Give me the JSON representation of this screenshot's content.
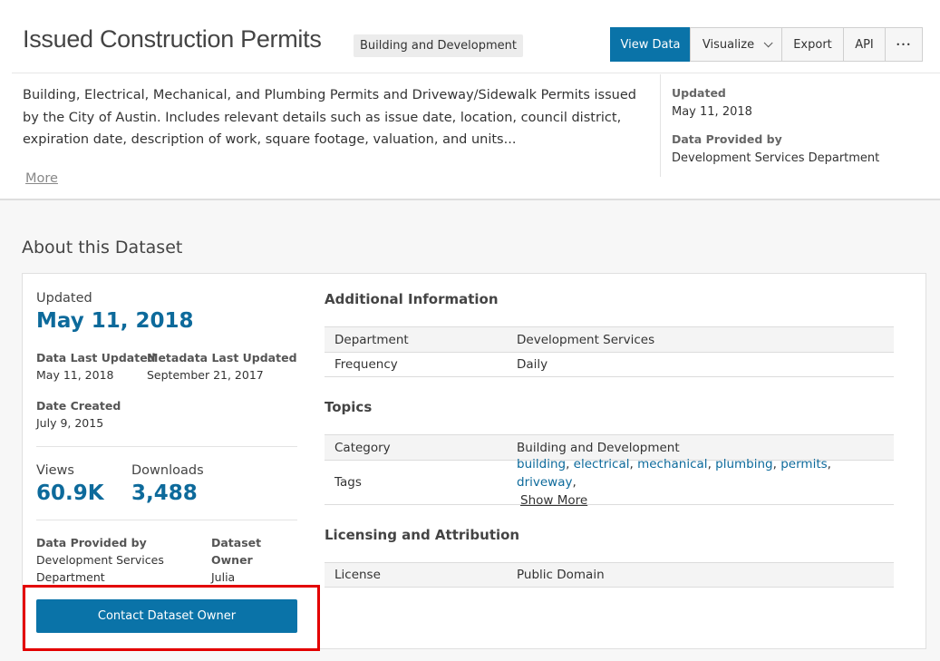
{
  "header": {
    "title": "Issued Construction Permits",
    "category": "Building and Development",
    "buttons": {
      "view_data": "View Data",
      "visualize": "Visualize",
      "export": "Export",
      "api": "API",
      "more": "•••"
    }
  },
  "summary": {
    "description": "Building, Electrical, Mechanical, and Plumbing Permits and Driveway/Sidewalk Permits issued by the City of Austin. Includes relevant details such as issue date, location, council district, expiration date, description of work, square footage, valuation, and units...",
    "more": "More",
    "updated_label": "Updated",
    "updated_value": "May 11, 2018",
    "provided_label": "Data Provided by",
    "provided_value": "Development Services Department"
  },
  "about": {
    "title": "About this Dataset",
    "updated_label": "Updated",
    "updated_value": "May 11, 2018",
    "data_last_updated_label": "Data Last Updated",
    "data_last_updated_value": "May 11, 2018",
    "metadata_last_updated_label": "Metadata Last Updated",
    "metadata_last_updated_value": "September 21, 2017",
    "date_created_label": "Date Created",
    "date_created_value": "July 9, 2015",
    "views_label": "Views",
    "views_value": "60.9K",
    "downloads_label": "Downloads",
    "downloads_value": "3,488",
    "provided_label": "Data Provided by",
    "provided_value_line1": "Development Services",
    "provided_value_line2": "Department",
    "owner_label_line1": "Dataset",
    "owner_label_line2": "Owner",
    "owner_value": "Julia",
    "contact_button": "Contact Dataset Owner"
  },
  "additional": {
    "title": "Additional Information",
    "rows": [
      {
        "key": "Department",
        "value": "Development Services"
      },
      {
        "key": "Frequency",
        "value": "Daily"
      }
    ]
  },
  "topics": {
    "title": "Topics",
    "category_key": "Category",
    "category_value": "Building and Development",
    "tags_key": "Tags",
    "tags": [
      "building",
      "electrical",
      "mechanical",
      "plumbing",
      "permits",
      "driveway"
    ],
    "show_more": "Show More"
  },
  "licensing": {
    "title": "Licensing and Attribution",
    "license_key": "License",
    "license_value": "Public Domain"
  }
}
